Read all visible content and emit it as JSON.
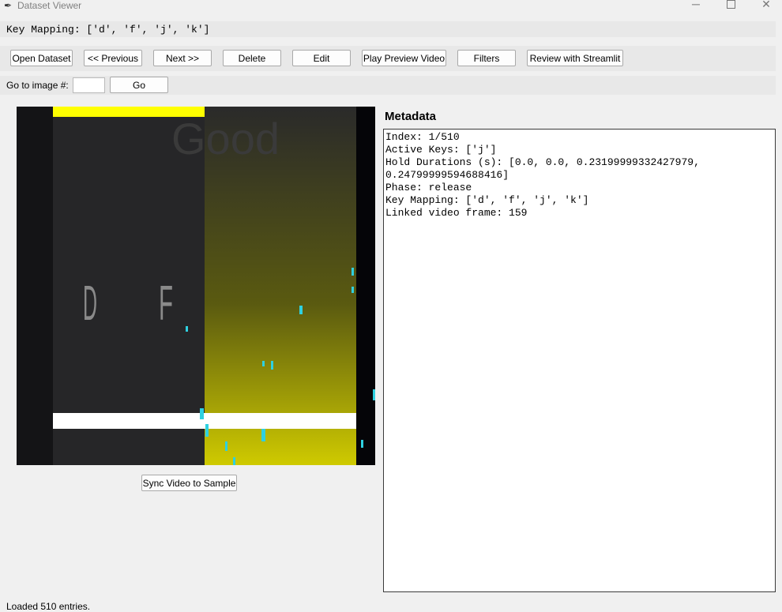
{
  "window": {
    "title": "Dataset Viewer",
    "minimize_glyph": "─",
    "close_glyph": "✕",
    "app_icon": "feather-icon"
  },
  "key_mapping_bar": {
    "text": "Key Mapping: ['d', 'f', 'j', 'k']"
  },
  "toolbar": {
    "open_dataset": "Open Dataset",
    "previous": "<< Previous",
    "next": "Next >>",
    "delete": "Delete",
    "edit": "Edit",
    "play_preview": "Play Preview Video",
    "filters": "Filters",
    "review_streamlit": "Review with Streamlit"
  },
  "goto": {
    "label": "Go to image #:",
    "value": "",
    "go_label": "Go"
  },
  "preview": {
    "lane_labels": [
      "D",
      "F"
    ],
    "watermark_text": "Good",
    "colors": {
      "highlight_lane": "#d4d000",
      "judgement_line": "#ffffff",
      "top_bar": "#ffff00",
      "particles": "#2fd0e0"
    }
  },
  "sync_button": "Sync Video to Sample",
  "metadata": {
    "title": "Metadata",
    "lines": [
      "Index: 1/510",
      "Active Keys: ['j']",
      "Hold Durations (s): [0.0, 0.0, 0.23199999332427979,",
      "0.24799999594688416]",
      "Phase: release",
      "Key Mapping: ['d', 'f', 'j', 'k']",
      "Linked video frame: 159"
    ]
  },
  "status": "Loaded 510 entries."
}
